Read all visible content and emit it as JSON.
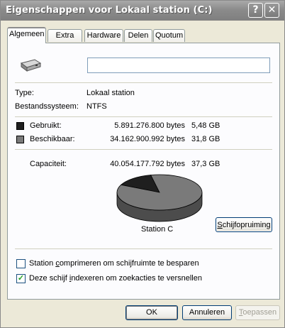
{
  "window": {
    "title": "Eigenschappen voor Lokaal station (C:)",
    "help_glyph": "?",
    "close_glyph": "✕"
  },
  "tabs": [
    {
      "label": "Algemeen",
      "active": true
    },
    {
      "label": "Extra"
    },
    {
      "label": "Hardware"
    },
    {
      "label": "Delen"
    },
    {
      "label": "Quotum"
    }
  ],
  "general": {
    "name_value": "",
    "type_label": "Type:",
    "type_value": "Lokaal station",
    "fs_label": "Bestandssysteem:",
    "fs_value": "NTFS",
    "used_label": "Gebruikt:",
    "used_bytes": "5.891.276.800 bytes",
    "used_size": "5,48 GB",
    "free_label": "Beschikbaar:",
    "free_bytes": "34.162.900.992 bytes",
    "free_size": "31,8 GB",
    "capacity_label": "Capaciteit:",
    "capacity_bytes": "40.054.177.792 bytes",
    "capacity_size": "37,3 GB",
    "drive_caption": "Station C",
    "cleanup_button_underlined": "S",
    "cleanup_button_rest": "chijfopruiming",
    "compress_pre": "Station ",
    "compress_u": "c",
    "compress_post": "omprimeren om schijfruimte te besparen",
    "compress_checked": false,
    "index_pre": "Deze schijf ",
    "index_u": "i",
    "index_post": "ndexeren om zoekacties te versnellen",
    "index_checked": true,
    "check_glyph": "✓"
  },
  "colors": {
    "used": "#1f1f1f",
    "free": "#7a7a7a"
  },
  "buttons": {
    "ok": "OK",
    "cancel": "Annuleren",
    "apply_underlined": "T",
    "apply_rest": "oepassen"
  },
  "chart_data": {
    "type": "pie",
    "categories": [
      "Gebruikt",
      "Beschikbaar"
    ],
    "values": [
      5891276800,
      34162900992
    ]
  }
}
